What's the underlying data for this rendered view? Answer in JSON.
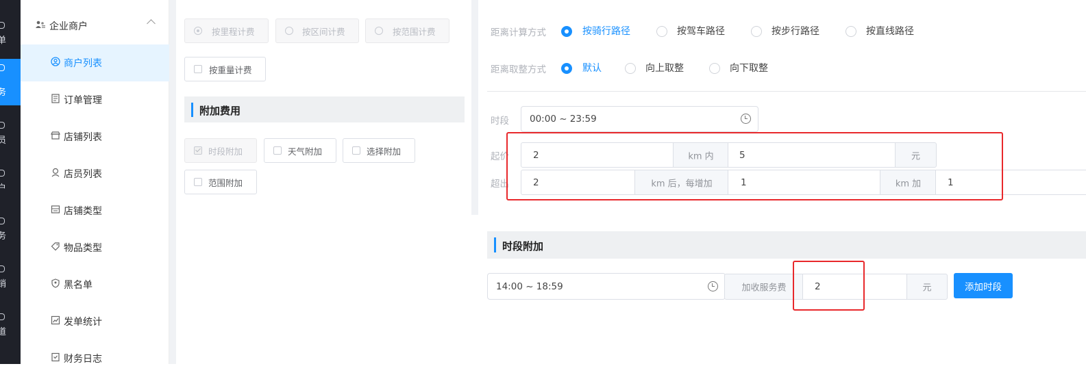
{
  "rail": {
    "items": [
      {
        "char": "单",
        "active": false
      },
      {
        "char": "务",
        "active": true
      },
      {
        "char": "员",
        "active": false
      },
      {
        "char": "户",
        "active": false
      },
      {
        "char": "务",
        "active": false
      },
      {
        "char": "销",
        "active": false
      },
      {
        "char": "道",
        "active": false
      }
    ]
  },
  "sidebar": {
    "group_title": "企业商户",
    "items": [
      {
        "label": "商户列表",
        "icon": "user-circle-icon",
        "active": true
      },
      {
        "label": "订单管理",
        "icon": "document-icon",
        "active": false
      },
      {
        "label": "店铺列表",
        "icon": "shop-icon",
        "active": false
      },
      {
        "label": "店员列表",
        "icon": "person-icon",
        "active": false
      },
      {
        "label": "店铺类型",
        "icon": "store-type-icon",
        "active": false
      },
      {
        "label": "物品类型",
        "icon": "tag-icon",
        "active": false
      },
      {
        "label": "黑名单",
        "icon": "shield-icon",
        "active": false
      },
      {
        "label": "发单统计",
        "icon": "chart-icon",
        "active": false
      },
      {
        "label": "财务日志",
        "icon": "log-icon",
        "active": false
      }
    ]
  },
  "billing": {
    "mode_options": [
      "按里程计费",
      "按区间计费",
      "按范围计费"
    ],
    "weight_option": "按重量计费",
    "extra_section_title": "附加费用",
    "extra_options": [
      "时段附加",
      "天气附加",
      "选择附加",
      "范围附加"
    ]
  },
  "distance": {
    "calc_label": "距离计算方式",
    "calc_options": [
      "按骑行路径",
      "按驾车路径",
      "按步行路径",
      "按直线路径"
    ],
    "calc_selected": 0,
    "round_label": "距离取整方式",
    "round_options": [
      "默认",
      "向上取整",
      "向下取整"
    ],
    "round_selected": 0
  },
  "pricing": {
    "period_label": "时段",
    "period_value": "00:00 ~ 23:59",
    "start_label": "起价",
    "start_km": "2",
    "start_km_unit": "km 内",
    "start_price": "5",
    "start_price_unit": "元",
    "over_label": "超出",
    "over_km": "2",
    "over_km_unit": "km 后，每增加",
    "over_step": "1",
    "over_step_unit": "km 加",
    "over_price": "1"
  },
  "time_surcharge": {
    "title": "时段附加",
    "range": "14:00 ~ 18:59",
    "fee_label": "加收服务费",
    "fee_value": "2",
    "fee_unit": "元",
    "add_button": "添加时段"
  },
  "colors": {
    "accent": "#1890ff",
    "highlight": "#e8282b",
    "rail": "#1f2129"
  }
}
